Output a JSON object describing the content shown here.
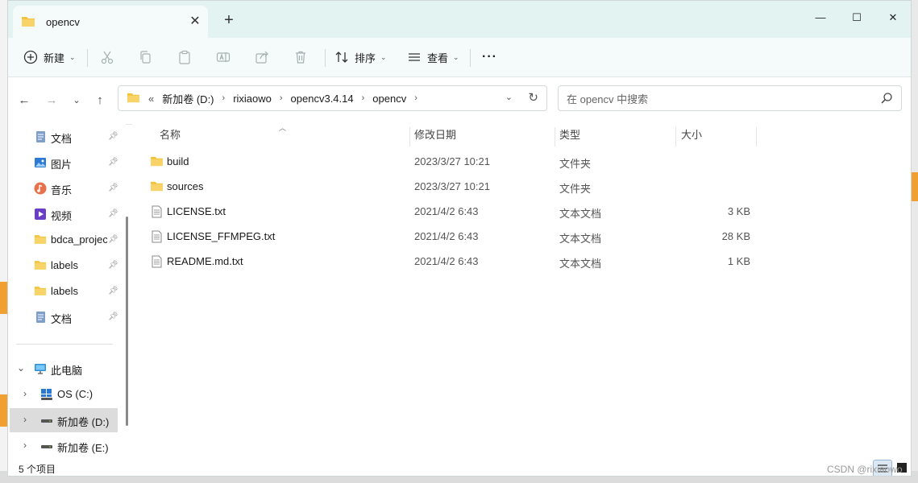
{
  "window": {
    "tab_title": "opencv",
    "new_tab_symbol": "+",
    "minimize_symbol": "—",
    "maximize_symbol": "☐",
    "close_symbol": "✕"
  },
  "toolbar": {
    "new_label": "新建",
    "sort_label": "排序",
    "view_label": "查看",
    "more_label": "···"
  },
  "address": {
    "overflow": "«",
    "crumbs": [
      "新加卷 (D:)",
      "rixiaowo",
      "opencv3.4.14",
      "opencv"
    ]
  },
  "search": {
    "placeholder": "在 opencv 中搜索"
  },
  "sidebar": {
    "quick_access": [
      {
        "label": "文档",
        "icon": "document-icon"
      },
      {
        "label": "图片",
        "icon": "picture-icon"
      },
      {
        "label": "音乐",
        "icon": "music-icon"
      },
      {
        "label": "视频",
        "icon": "video-icon"
      },
      {
        "label": "bdca_project",
        "icon": "folder-icon"
      },
      {
        "label": "labels",
        "icon": "folder-icon"
      },
      {
        "label": "labels",
        "icon": "folder-icon"
      },
      {
        "label": "文档",
        "icon": "document-icon"
      }
    ],
    "this_pc": "此电脑",
    "drives": [
      {
        "label": "OS (C:)",
        "icon": "windows-drive-icon"
      },
      {
        "label": "新加卷 (D:)",
        "icon": "drive-icon"
      },
      {
        "label": "新加卷 (E:)",
        "icon": "drive-icon"
      }
    ]
  },
  "files": {
    "headers": {
      "name": "名称",
      "date": "修改日期",
      "type": "类型",
      "size": "大小"
    },
    "rows": [
      {
        "name": "build",
        "date": "2023/3/27 10:21",
        "type": "文件夹",
        "size": "",
        "kind": "folder"
      },
      {
        "name": "sources",
        "date": "2023/3/27 10:21",
        "type": "文件夹",
        "size": "",
        "kind": "folder"
      },
      {
        "name": "LICENSE.txt",
        "date": "2021/4/2 6:43",
        "type": "文本文档",
        "size": "3 KB",
        "kind": "text"
      },
      {
        "name": "LICENSE_FFMPEG.txt",
        "date": "2021/4/2 6:43",
        "type": "文本文档",
        "size": "28 KB",
        "kind": "text"
      },
      {
        "name": "README.md.txt",
        "date": "2021/4/2 6:43",
        "type": "文本文档",
        "size": "1 KB",
        "kind": "text"
      }
    ]
  },
  "status": {
    "item_count": "5 个项目",
    "watermark": "CSDN @rixiaowo"
  },
  "colors": {
    "titlebar": "#e3f3f2",
    "toolbar": "#f5fbfb",
    "folder": "#f4c23b",
    "accent": "#f0a030"
  }
}
